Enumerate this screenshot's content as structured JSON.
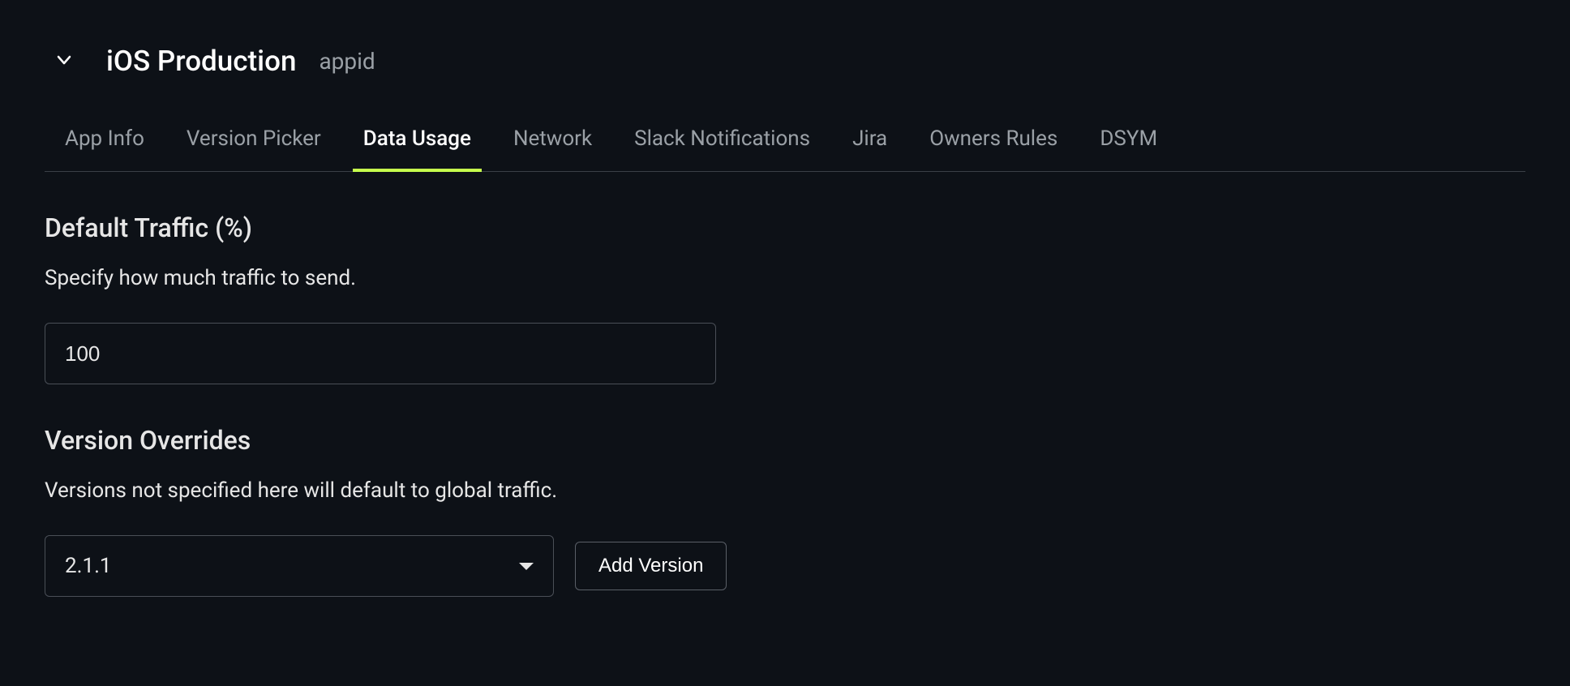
{
  "header": {
    "title": "iOS Production",
    "subtitle": "appid"
  },
  "tabs": [
    {
      "label": "App Info"
    },
    {
      "label": "Version Picker"
    },
    {
      "label": "Data Usage"
    },
    {
      "label": "Network"
    },
    {
      "label": "Slack Notifications"
    },
    {
      "label": "Jira"
    },
    {
      "label": "Owners Rules"
    },
    {
      "label": "DSYM"
    }
  ],
  "section_traffic": {
    "title": "Default Traffic (%)",
    "desc": "Specify how much traffic to send.",
    "value": "100"
  },
  "section_overrides": {
    "title": "Version Overrides",
    "desc": "Versions not specified here will default to global traffic.",
    "selected_version": "2.1.1",
    "add_button": "Add Version"
  }
}
